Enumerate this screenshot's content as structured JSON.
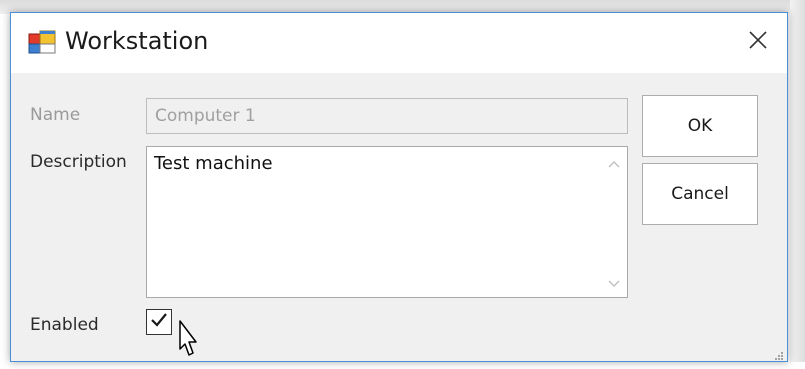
{
  "window": {
    "title": "Workstation",
    "icon": "app-window-icon",
    "close_icon": "close-icon"
  },
  "form": {
    "name_label": "Name",
    "name_value": "Computer 1",
    "description_label": "Description",
    "description_value": "Test machine",
    "enabled_label": "Enabled",
    "enabled_checked": true
  },
  "buttons": {
    "ok_label": "OK",
    "cancel_label": "Cancel"
  },
  "colors": {
    "window_border": "#4a8fd6",
    "dialog_background": "#f0f0f0",
    "disabled_text": "#9a9a9a"
  }
}
